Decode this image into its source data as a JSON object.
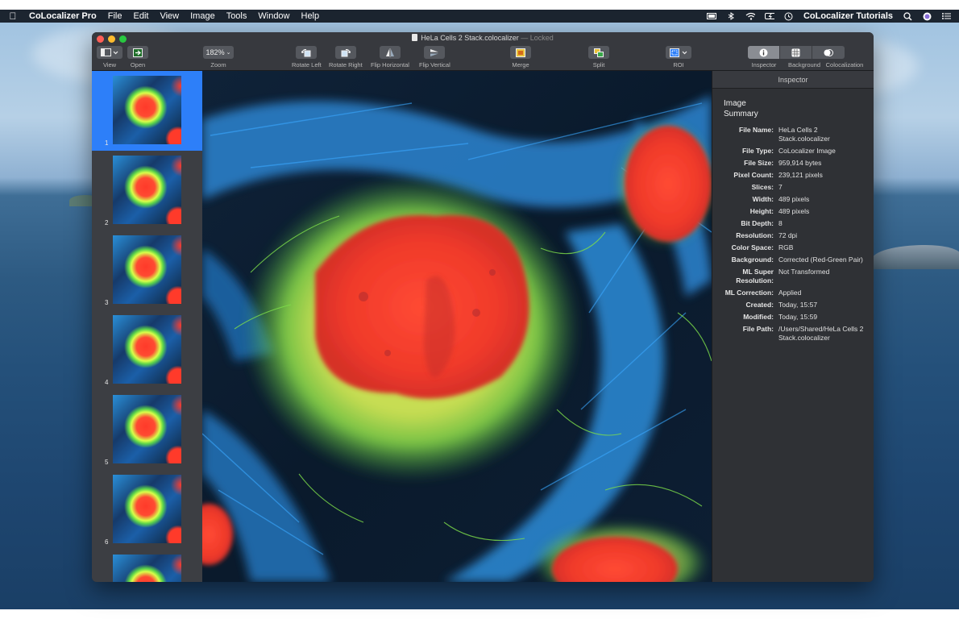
{
  "menubar": {
    "app_name": "CoLocalizer Pro",
    "menus": [
      "File",
      "Edit",
      "View",
      "Image",
      "Tools",
      "Window",
      "Help"
    ],
    "right_label": "CoLocalizer Tutorials"
  },
  "window": {
    "title": "HeLa Cells 2 Stack.colocalizer",
    "title_separator": " — ",
    "title_status": "Locked"
  },
  "toolbar": {
    "view_label": "View",
    "open_label": "Open",
    "zoom_value": "182%",
    "zoom_label": "Zoom",
    "rotate_left_label": "Rotate Left",
    "rotate_right_label": "Rotate Right",
    "flip_horizontal_label": "Flip Horizontal",
    "flip_vertical_label": "Flip Vertical",
    "merge_label": "Merge",
    "split_label": "Split",
    "roi_label": "ROI",
    "panel_labels": [
      "Inspector",
      "Background",
      "Colocalization"
    ]
  },
  "sidebar": {
    "slices": [
      "1",
      "2",
      "3",
      "4",
      "5",
      "6",
      ""
    ],
    "selected_index": 0
  },
  "inspector": {
    "header": "Inspector",
    "summary_title": "Image Summary",
    "rows": [
      {
        "k": "File Name:",
        "v": "HeLa Cells 2 Stack.colocalizer"
      },
      {
        "k": "File Type:",
        "v": "CoLocalizer Image"
      },
      {
        "k": "File Size:",
        "v": "959,914 bytes"
      },
      {
        "k": "Pixel Count:",
        "v": "239,121 pixels"
      },
      {
        "k": "Slices:",
        "v": "7"
      },
      {
        "k": "Width:",
        "v": "489 pixels"
      },
      {
        "k": "Height:",
        "v": "489 pixels"
      },
      {
        "k": "Bit Depth:",
        "v": "8"
      },
      {
        "k": "Resolution:",
        "v": "72 dpi"
      },
      {
        "k": "Color Space:",
        "v": "RGB"
      },
      {
        "k": "Background:",
        "v": "Corrected (Red-Green Pair)"
      },
      {
        "k": "ML Super Resolution:",
        "v": "Not Transformed"
      },
      {
        "k": "ML Correction:",
        "v": "Applied"
      },
      {
        "k": "Created:",
        "v": "Today, 15:57"
      },
      {
        "k": "Modified:",
        "v": "Today, 15:59"
      },
      {
        "k": "File Path:",
        "v": "/Users/Shared/HeLa Cells 2 Stack.colocalizer"
      }
    ]
  },
  "colors": {
    "selection": "#2d7ff9",
    "nucleus_red": "#ff3a2a",
    "mito_green": "#7ee04a",
    "actin_blue": "#2a8fd8"
  }
}
